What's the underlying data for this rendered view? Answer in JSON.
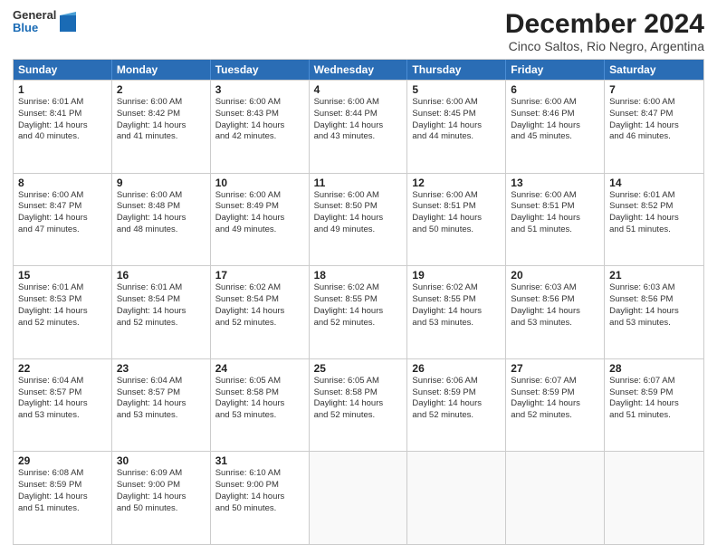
{
  "logo": {
    "general": "General",
    "blue": "Blue"
  },
  "title": "December 2024",
  "subtitle": "Cinco Saltos, Rio Negro, Argentina",
  "weekdays": [
    "Sunday",
    "Monday",
    "Tuesday",
    "Wednesday",
    "Thursday",
    "Friday",
    "Saturday"
  ],
  "weeks": [
    [
      {
        "day": "1",
        "sunrise": "6:01 AM",
        "sunset": "8:41 PM",
        "daylight": "14 hours and 40 minutes."
      },
      {
        "day": "2",
        "sunrise": "6:00 AM",
        "sunset": "8:42 PM",
        "daylight": "14 hours and 41 minutes."
      },
      {
        "day": "3",
        "sunrise": "6:00 AM",
        "sunset": "8:43 PM",
        "daylight": "14 hours and 42 minutes."
      },
      {
        "day": "4",
        "sunrise": "6:00 AM",
        "sunset": "8:44 PM",
        "daylight": "14 hours and 43 minutes."
      },
      {
        "day": "5",
        "sunrise": "6:00 AM",
        "sunset": "8:45 PM",
        "daylight": "14 hours and 44 minutes."
      },
      {
        "day": "6",
        "sunrise": "6:00 AM",
        "sunset": "8:46 PM",
        "daylight": "14 hours and 45 minutes."
      },
      {
        "day": "7",
        "sunrise": "6:00 AM",
        "sunset": "8:47 PM",
        "daylight": "14 hours and 46 minutes."
      }
    ],
    [
      {
        "day": "8",
        "sunrise": "6:00 AM",
        "sunset": "8:47 PM",
        "daylight": "14 hours and 47 minutes."
      },
      {
        "day": "9",
        "sunrise": "6:00 AM",
        "sunset": "8:48 PM",
        "daylight": "14 hours and 48 minutes."
      },
      {
        "day": "10",
        "sunrise": "6:00 AM",
        "sunset": "8:49 PM",
        "daylight": "14 hours and 49 minutes."
      },
      {
        "day": "11",
        "sunrise": "6:00 AM",
        "sunset": "8:50 PM",
        "daylight": "14 hours and 49 minutes."
      },
      {
        "day": "12",
        "sunrise": "6:00 AM",
        "sunset": "8:51 PM",
        "daylight": "14 hours and 50 minutes."
      },
      {
        "day": "13",
        "sunrise": "6:00 AM",
        "sunset": "8:51 PM",
        "daylight": "14 hours and 51 minutes."
      },
      {
        "day": "14",
        "sunrise": "6:01 AM",
        "sunset": "8:52 PM",
        "daylight": "14 hours and 51 minutes."
      }
    ],
    [
      {
        "day": "15",
        "sunrise": "6:01 AM",
        "sunset": "8:53 PM",
        "daylight": "14 hours and 52 minutes."
      },
      {
        "day": "16",
        "sunrise": "6:01 AM",
        "sunset": "8:54 PM",
        "daylight": "14 hours and 52 minutes."
      },
      {
        "day": "17",
        "sunrise": "6:02 AM",
        "sunset": "8:54 PM",
        "daylight": "14 hours and 52 minutes."
      },
      {
        "day": "18",
        "sunrise": "6:02 AM",
        "sunset": "8:55 PM",
        "daylight": "14 hours and 52 minutes."
      },
      {
        "day": "19",
        "sunrise": "6:02 AM",
        "sunset": "8:55 PM",
        "daylight": "14 hours and 53 minutes."
      },
      {
        "day": "20",
        "sunrise": "6:03 AM",
        "sunset": "8:56 PM",
        "daylight": "14 hours and 53 minutes."
      },
      {
        "day": "21",
        "sunrise": "6:03 AM",
        "sunset": "8:56 PM",
        "daylight": "14 hours and 53 minutes."
      }
    ],
    [
      {
        "day": "22",
        "sunrise": "6:04 AM",
        "sunset": "8:57 PM",
        "daylight": "14 hours and 53 minutes."
      },
      {
        "day": "23",
        "sunrise": "6:04 AM",
        "sunset": "8:57 PM",
        "daylight": "14 hours and 53 minutes."
      },
      {
        "day": "24",
        "sunrise": "6:05 AM",
        "sunset": "8:58 PM",
        "daylight": "14 hours and 53 minutes."
      },
      {
        "day": "25",
        "sunrise": "6:05 AM",
        "sunset": "8:58 PM",
        "daylight": "14 hours and 52 minutes."
      },
      {
        "day": "26",
        "sunrise": "6:06 AM",
        "sunset": "8:59 PM",
        "daylight": "14 hours and 52 minutes."
      },
      {
        "day": "27",
        "sunrise": "6:07 AM",
        "sunset": "8:59 PM",
        "daylight": "14 hours and 52 minutes."
      },
      {
        "day": "28",
        "sunrise": "6:07 AM",
        "sunset": "8:59 PM",
        "daylight": "14 hours and 51 minutes."
      }
    ],
    [
      {
        "day": "29",
        "sunrise": "6:08 AM",
        "sunset": "8:59 PM",
        "daylight": "14 hours and 51 minutes."
      },
      {
        "day": "30",
        "sunrise": "6:09 AM",
        "sunset": "9:00 PM",
        "daylight": "14 hours and 50 minutes."
      },
      {
        "day": "31",
        "sunrise": "6:10 AM",
        "sunset": "9:00 PM",
        "daylight": "14 hours and 50 minutes."
      },
      null,
      null,
      null,
      null
    ]
  ],
  "labels": {
    "sunrise": "Sunrise:",
    "sunset": "Sunset:",
    "daylight": "Daylight:"
  }
}
